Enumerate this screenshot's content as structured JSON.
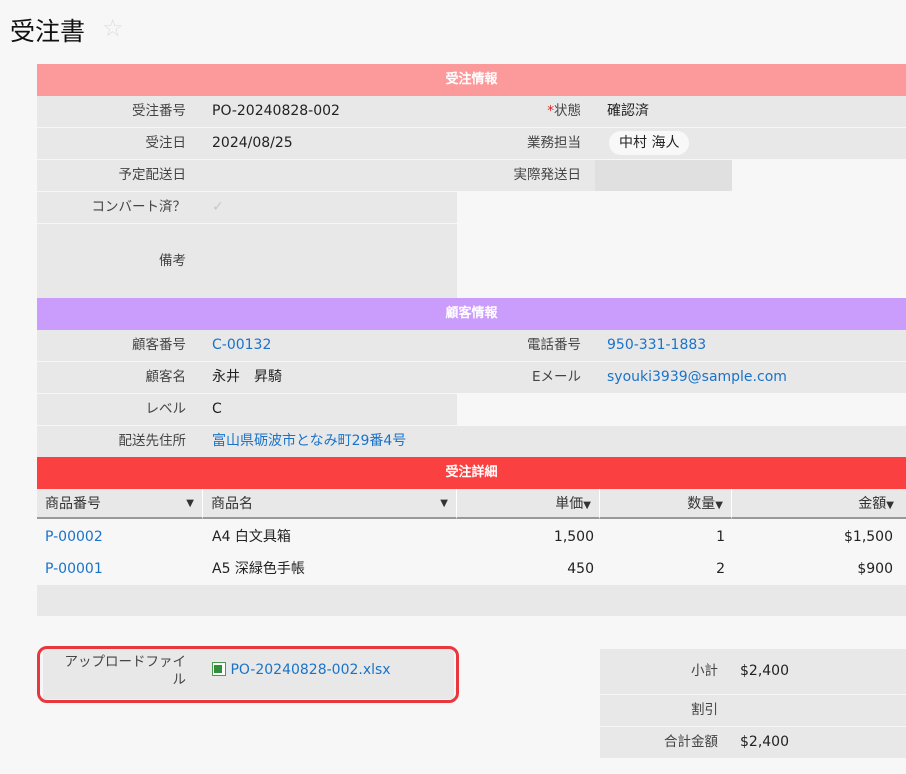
{
  "page": {
    "title": "受注書"
  },
  "sections": {
    "order": "受注情報",
    "customer": "顧客情報",
    "detail": "受注詳細"
  },
  "order": {
    "order_no_label": "受注番号",
    "order_no": "PO-20240828-002",
    "status_label": "状態",
    "status_required_mark": "*",
    "status": "確認済",
    "order_date_label": "受注日",
    "order_date": "2024/08/25",
    "staff_label": "業務担当",
    "staff": "中村 海人",
    "planned_ship_label": "予定配送日",
    "planned_ship": "",
    "actual_ship_label": "実際発送日",
    "actual_ship": "",
    "converted_label": "コンバート済？",
    "notes_label": "備考",
    "notes": ""
  },
  "customer": {
    "no_label": "顧客番号",
    "no": "C-00132",
    "phone_label": "電話番号",
    "phone": "950-331-1883",
    "name_label": "顧客名",
    "name": "永井　昇騎",
    "email_label": "Eメール",
    "email": "syouki3939@sample.com",
    "level_label": "レベル",
    "level": "C",
    "address_label": "配送先住所",
    "address": "富山県砺波市となみ町29番4号"
  },
  "detail": {
    "columns": [
      "商品番号",
      "商品名",
      "単価",
      "数量",
      "金額"
    ],
    "rows": [
      {
        "code": "P-00002",
        "name": "A4 白文具箱",
        "price": "1,500",
        "qty": "1",
        "amount": "$1,500"
      },
      {
        "code": "P-00001",
        "name": "A5 深緑色手帳",
        "price": "450",
        "qty": "2",
        "amount": "$900"
      }
    ]
  },
  "upload": {
    "label_line1": "アップロードファイ",
    "label_line2": "ル",
    "file": "PO-20240828-002.xlsx"
  },
  "totals": {
    "subtotal_label": "小計",
    "subtotal": "$2,400",
    "discount_label": "割引",
    "discount": "",
    "total_label": "合計金額",
    "total": "$2,400"
  },
  "colors": {
    "order_header": "#fc9a9b",
    "customer_header": "#ca9cfb",
    "detail_header": "#fb4042",
    "link": "#1a73c9",
    "highlight": "#e8383d"
  }
}
